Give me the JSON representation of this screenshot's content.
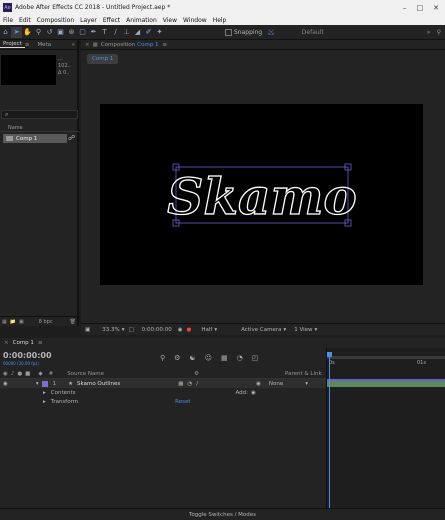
{
  "window": {
    "title": "Adobe After Effects CC 2018 - Untitled Project.aep *",
    "app_badge": "Ae"
  },
  "menu": [
    "File",
    "Edit",
    "Composition",
    "Layer",
    "Effect",
    "Animation",
    "View",
    "Window",
    "Help"
  ],
  "toolbar": {
    "snapping_label": "Snapping",
    "workspace_label": "Default"
  },
  "project": {
    "tabs": [
      "Project",
      "Meta"
    ],
    "info_lines": [
      "...",
      "102..",
      "Δ 0.."
    ],
    "search_placeholder": "⌕",
    "column_name": "Name",
    "items": [
      {
        "name": "Comp 1"
      }
    ],
    "footer_bpc": "8 bpc"
  },
  "composition": {
    "tab_prefix": "Composition",
    "tab_name": "Comp 1",
    "breadcrumb": "Comp 1",
    "viewer_text": "Skamo"
  },
  "viewer_controls": {
    "zoom": "33.3%",
    "timecode": "0:00:00:00",
    "resolution": "Half",
    "camera": "Active Camera",
    "views": "1 View"
  },
  "timeline": {
    "tab": "Comp 1",
    "current_time": "0:00:00:00",
    "fps_hint": "00000 (30.00 fps)",
    "col_source": "Source Name",
    "col_parent": "Parent & Link",
    "layers": [
      {
        "index": "1",
        "name": "Skamo Outlines",
        "parent": "None"
      }
    ],
    "sublayers": [
      {
        "name": "Contents",
        "action": "Add:"
      },
      {
        "name": "Transform",
        "action": "Reset"
      }
    ],
    "ruler_start": "0s",
    "ruler_end": "01s",
    "footer": "Toggle Switches / Modes"
  },
  "colors": {
    "accent": "#4c8fe8",
    "layer_label": "#7a6fd6",
    "track_bar": "#5c8a5c"
  }
}
